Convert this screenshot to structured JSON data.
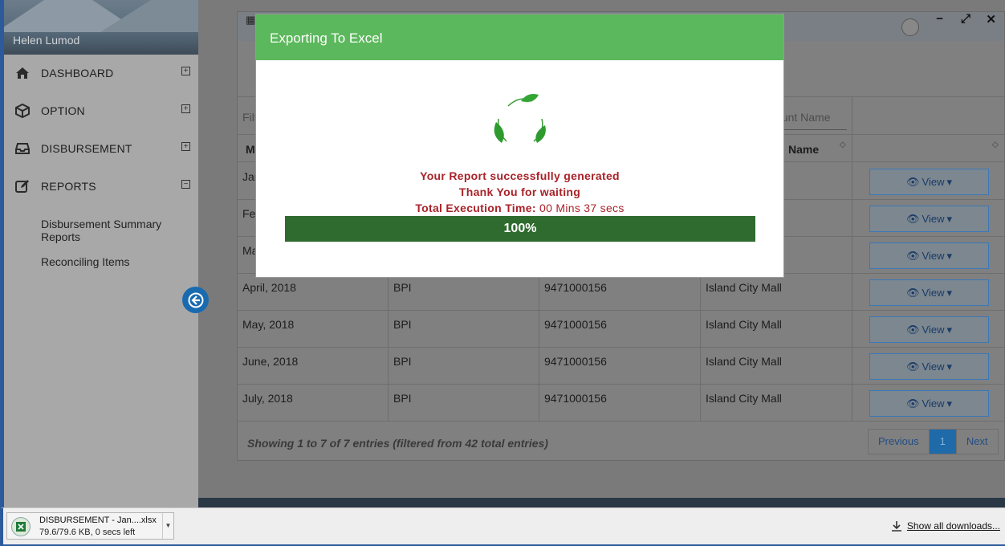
{
  "sidebar": {
    "user_name": "Helen Lumod",
    "items": [
      {
        "label": "DASHBOARD",
        "toggle": "⊞"
      },
      {
        "label": "OPTION",
        "toggle": "⊞"
      },
      {
        "label": "DISBURSEMENT",
        "toggle": "⊞"
      },
      {
        "label": "REPORTS",
        "toggle": "⊟"
      }
    ],
    "subitems": [
      "Disbursement Summary Reports",
      "Reconciling Items"
    ]
  },
  "panel": {
    "filter_left_placeholder": "Filt",
    "filter_right_placeholder": "ount Name",
    "header_col1": "M",
    "header_col4": "Name",
    "rows": [
      {
        "month": "Jan",
        "bank": "",
        "account": "",
        "name": "",
        "action": "View"
      },
      {
        "month": "Fe",
        "bank": "",
        "account": "",
        "name": "",
        "action": "View"
      },
      {
        "month": "Ma",
        "bank": "",
        "account": "",
        "name": "",
        "action": "View"
      },
      {
        "month": "April, 2018",
        "bank": "BPI",
        "account": "9471000156",
        "name": "Island City Mall",
        "action": "View"
      },
      {
        "month": "May, 2018",
        "bank": "BPI",
        "account": "9471000156",
        "name": "Island City Mall",
        "action": "View"
      },
      {
        "month": "June, 2018",
        "bank": "BPI",
        "account": "9471000156",
        "name": "Island City Mall",
        "action": "View"
      },
      {
        "month": "July, 2018",
        "bank": "BPI",
        "account": "9471000156",
        "name": "Island City Mall",
        "action": "View"
      }
    ],
    "footer_text": "Showing 1 to 7 of 7 entries (filtered from 42 total entries)",
    "pager": {
      "previous": "Previous",
      "current": "1",
      "next": "Next"
    }
  },
  "modal": {
    "title": "Exporting To Excel",
    "line1": "Your Report successfully generated",
    "line2": "Thank You for waiting",
    "exec_label": "Total Execution Time:",
    "exec_value": "00 Mins 37 secs",
    "progress_text": "100%",
    "progress_value": 1.0
  },
  "download": {
    "file_name": "DISBURSEMENT - Jan....xlsx",
    "status": "79.6/79.6 KB, 0 secs left",
    "show_all": "Show all downloads..."
  },
  "colors": {
    "accent_green": "#5cb85c",
    "progress_green": "#2f6b2f",
    "message_red": "#a8232a",
    "primary_blue": "#1f6aa9"
  }
}
